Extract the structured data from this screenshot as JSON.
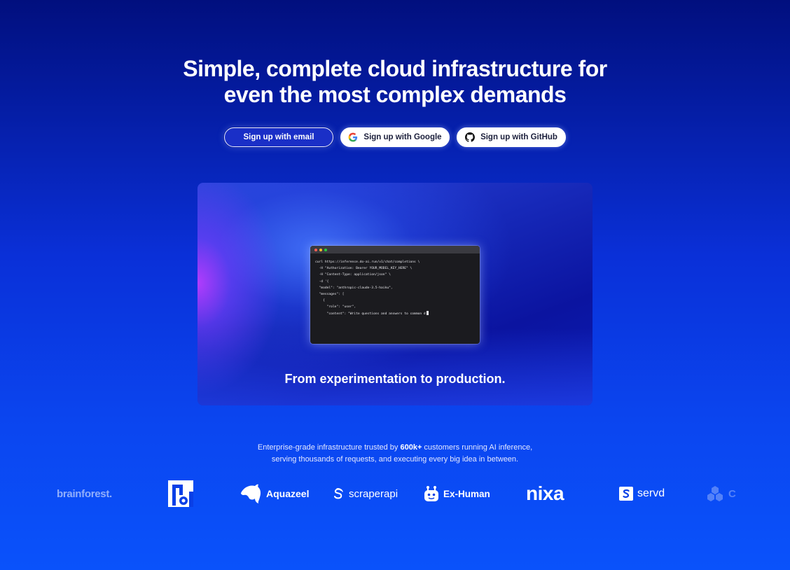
{
  "hero": {
    "title_line1": "Simple, complete cloud infrastructure for",
    "title_line2": "even the most complex demands"
  },
  "cta": {
    "email_label": "Sign up with email",
    "google_label": "Sign up with Google",
    "github_label": "Sign up with GitHub",
    "google_icon": "google-icon",
    "github_icon": "github-icon"
  },
  "showcase": {
    "caption": "From experimentation to production.",
    "terminal": {
      "lines": [
        "curl https://inference.do-ai.run/v1/chat/completions \\",
        "  -H \"Authorization: Bearer YOUR_MODEL_KEY_HERE\" \\",
        "  -H \"Content-Type: application/json\" \\",
        "  -d '{",
        "  \"model\": \"anthropic-claude-3.5-haiku\",",
        "  \"messages\": [",
        "    {",
        "      \"role\": \"user\",",
        "      \"content\": \"Write questions and answers to common d"
      ]
    }
  },
  "trust": {
    "line1_prefix": "Enterprise-grade infrastructure trusted by ",
    "line1_bold": "600k+",
    "line1_suffix": " customers running AI inference,",
    "line2": "serving thousands of requests, and executing every big idea in between."
  },
  "logos": {
    "brainforest": "brainforest.",
    "nb": "nb",
    "aquazeel": "Aquazeel",
    "scraperapi": "scraperapi",
    "exhuman": "Ex-Human",
    "nixa": "nixa",
    "servd": "servd",
    "faded": "C"
  },
  "colors": {
    "background_top": "#010f7e",
    "background_bottom": "#0a52fb",
    "terminal_bg": "#1b1b1f"
  }
}
